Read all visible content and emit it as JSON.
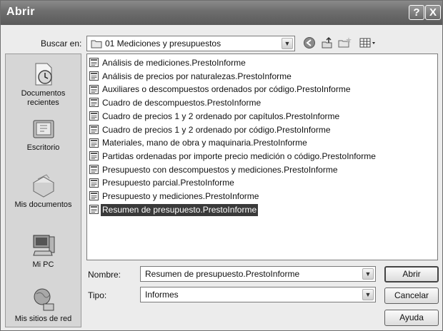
{
  "dialog": {
    "title": "Abrir"
  },
  "titlebar": {
    "help_glyph": "?",
    "close_glyph": "X"
  },
  "look_in": {
    "label": "Buscar en:",
    "value": "01 Mediciones y presupuestos"
  },
  "toolbar": {
    "icons": [
      "back-icon",
      "up-folder-icon",
      "new-folder-icon",
      "view-menu-icon"
    ]
  },
  "places": [
    {
      "label": "Documentos recientes",
      "icon": "recent-documents-icon"
    },
    {
      "label": "Escritorio",
      "icon": "desktop-icon"
    },
    {
      "label": "Mis documentos",
      "icon": "my-documents-icon"
    },
    {
      "label": "Mi PC",
      "icon": "my-computer-icon"
    },
    {
      "label": "Mis sitios de red",
      "icon": "network-places-icon"
    }
  ],
  "files": [
    "Análisis de mediciones.PrestoInforme",
    "Análisis de precios por naturalezas.PrestoInforme",
    "Auxiliares o descompuestos ordenados por código.PrestoInforme",
    "Cuadro de descompuestos.PrestoInforme",
    "Cuadro de precios 1 y 2 ordenado por capítulos.PrestoInforme",
    "Cuadro de precios 1 y 2 ordenado por código.PrestoInforme",
    "Materiales, mano de obra y maquinaria.PrestoInforme",
    "Partidas ordenadas por importe precio medición o código.PrestoInforme",
    "Presupuesto con descompuestos y mediciones.PrestoInforme",
    "Presupuesto parcial.PrestoInforme",
    "Presupuesto y mediciones.PrestoInforme",
    "Resumen de presupuesto.PrestoInforme"
  ],
  "selected_file_index": 11,
  "filename": {
    "label": "Nombre:",
    "value": "Resumen de presupuesto.PrestoInforme"
  },
  "filetype": {
    "label": "Tipo:",
    "value": "Informes"
  },
  "buttons": {
    "open": "Abrir",
    "cancel": "Cancelar",
    "help": "Ayuda"
  }
}
